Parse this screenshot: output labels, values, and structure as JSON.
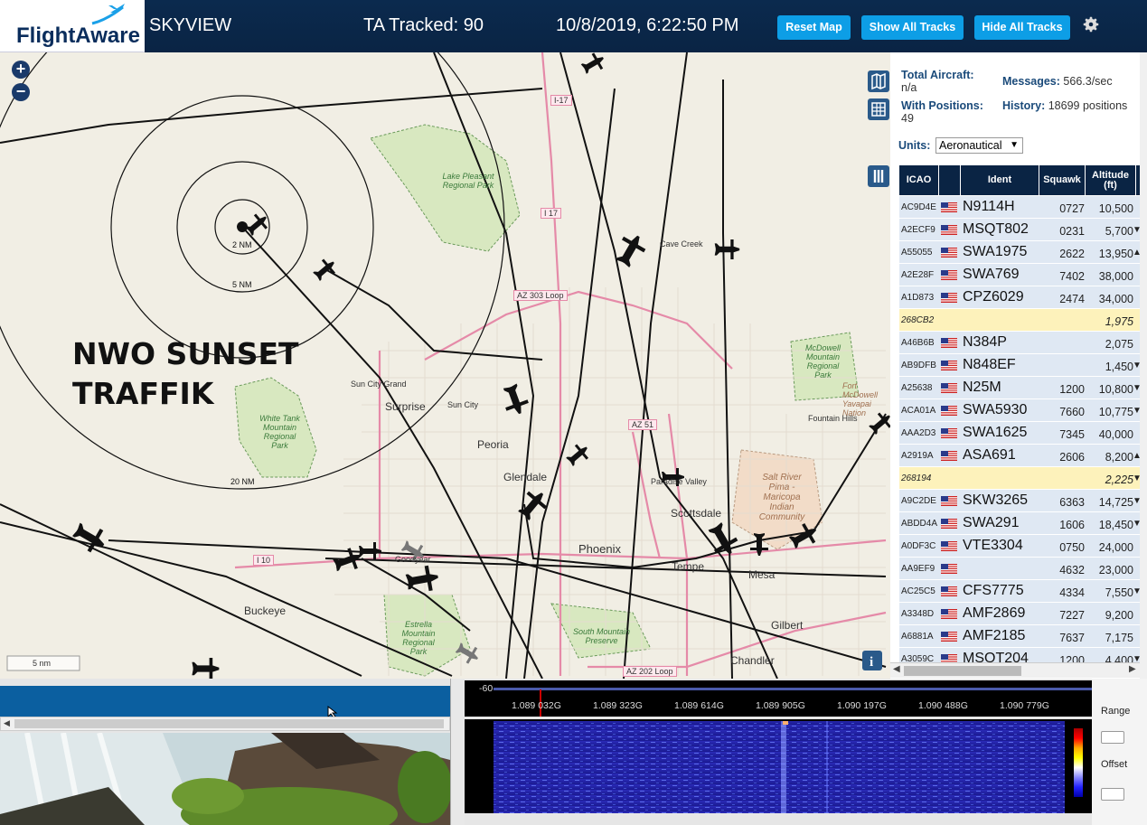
{
  "header": {
    "logo": "FlightAware",
    "app": "SKYVIEW",
    "tracked": "TA Tracked: 90",
    "datetime": "10/8/2019, 6:22:50 PM",
    "btn_reset": "Reset Map",
    "btn_show": "Show All Tracks",
    "btn_hide": "Hide All Tracks",
    "gear_icon": "gear-icon"
  },
  "map": {
    "overlay_line1": "NWO SUNSET",
    "overlay_line2": "TRAFFIK",
    "rings": [
      "2 NM",
      "5 NM",
      "20 NM"
    ],
    "places": [
      "Lake Pleasant Regional Park",
      "Cave Creek",
      "AZ 303 Loop",
      "McDowell Mountain Regional Park",
      "Fort McDowell Yavapai Nation",
      "Fountain Hills",
      "Sun City Grand",
      "Surprise",
      "Sun City",
      "Peoria",
      "White Tank Mountain Regional Park",
      "Glendale",
      "Paradise Valley",
      "Salt River Pima - Maricopa Indian Community",
      "Scottsdale",
      "Phoenix",
      "Goodyear",
      "Tempe",
      "Mesa",
      "Buckeye",
      "Estrella Mountain Regional Park",
      "South Mountain Preserve",
      "Gilbert",
      "Chandler",
      "AZ 202 Loop",
      "I-17",
      "I 17",
      "I 10",
      "AZ 51"
    ],
    "scale": "5 nm"
  },
  "panel": {
    "total_label": "Total Aircraft:",
    "total_value": "n/a",
    "messages_label": "Messages:",
    "messages_value": "566.3/sec",
    "positions_label": "With Positions:",
    "positions_value": "49",
    "history_label": "History:",
    "history_value": "18699 positions",
    "units_label": "Units:",
    "units_value": "Aeronautical"
  },
  "table": {
    "headers": [
      "ICAO",
      "",
      "Ident",
      "Squawk",
      "Altitude (ft)"
    ],
    "rows": [
      {
        "icao": "AC9D4E",
        "flag": true,
        "ident": "N9114H",
        "squawk": "0727",
        "alt": "10,500",
        "trend": ""
      },
      {
        "icao": "A2ECF9",
        "flag": true,
        "ident": "MSQT802",
        "squawk": "0231",
        "alt": "5,700",
        "trend": "▼"
      },
      {
        "icao": "A55055",
        "flag": true,
        "ident": "SWA1975",
        "squawk": "2622",
        "alt": "13,950",
        "trend": "▲"
      },
      {
        "icao": "A2E28F",
        "flag": true,
        "ident": "SWA769",
        "squawk": "7402",
        "alt": "38,000",
        "trend": ""
      },
      {
        "icao": "A1D873",
        "flag": true,
        "ident": "CPZ6029",
        "squawk": "2474",
        "alt": "34,000",
        "trend": ""
      },
      {
        "icao": "268CB2",
        "flag": false,
        "ident": "",
        "squawk": "",
        "alt": "1,975",
        "trend": "",
        "sel": true
      },
      {
        "icao": "A46B6B",
        "flag": true,
        "ident": "N384P",
        "squawk": "",
        "alt": "2,075",
        "trend": ""
      },
      {
        "icao": "AB9DFB",
        "flag": true,
        "ident": "N848EF",
        "squawk": "",
        "alt": "1,450",
        "trend": "▼"
      },
      {
        "icao": "A25638",
        "flag": true,
        "ident": "N25M",
        "squawk": "1200",
        "alt": "10,800",
        "trend": "▼"
      },
      {
        "icao": "ACA01A",
        "flag": true,
        "ident": "SWA5930",
        "squawk": "7660",
        "alt": "10,775",
        "trend": "▼"
      },
      {
        "icao": "AAA2D3",
        "flag": true,
        "ident": "SWA1625",
        "squawk": "7345",
        "alt": "40,000",
        "trend": ""
      },
      {
        "icao": "A2919A",
        "flag": true,
        "ident": "ASA691",
        "squawk": "2606",
        "alt": "8,200",
        "trend": "▲"
      },
      {
        "icao": "268194",
        "flag": false,
        "ident": "",
        "squawk": "",
        "alt": "2,225",
        "trend": "▼",
        "sel": true
      },
      {
        "icao": "A9C2DE",
        "flag": true,
        "ident": "SKW3265",
        "squawk": "6363",
        "alt": "14,725",
        "trend": "▼"
      },
      {
        "icao": "ABDD4A",
        "flag": true,
        "ident": "SWA291",
        "squawk": "1606",
        "alt": "18,450",
        "trend": "▼"
      },
      {
        "icao": "A0DF3C",
        "flag": true,
        "ident": "VTE3304",
        "squawk": "0750",
        "alt": "24,000",
        "trend": ""
      },
      {
        "icao": "AA9EF9",
        "flag": true,
        "ident": "",
        "squawk": "4632",
        "alt": "23,000",
        "trend": ""
      },
      {
        "icao": "AC25C5",
        "flag": true,
        "ident": "CFS7775",
        "squawk": "4334",
        "alt": "7,550",
        "trend": "▼"
      },
      {
        "icao": "A3348D",
        "flag": true,
        "ident": "AMF2869",
        "squawk": "7227",
        "alt": "9,200",
        "trend": ""
      },
      {
        "icao": "A6881A",
        "flag": true,
        "ident": "AMF2185",
        "squawk": "7637",
        "alt": "7,175",
        "trend": ""
      },
      {
        "icao": "A3059C",
        "flag": true,
        "ident": "MSQT204",
        "squawk": "1200",
        "alt": "4,400",
        "trend": "▼"
      }
    ]
  },
  "spectrum": {
    "scale_label": "-60",
    "freqs": [
      "1.089 032G",
      "1.089 323G",
      "1.089 614G",
      "1.089 905G",
      "1.090 197G",
      "1.090 488G",
      "1.090 779G"
    ],
    "range_label": "Range",
    "offset_label": "Offset"
  }
}
